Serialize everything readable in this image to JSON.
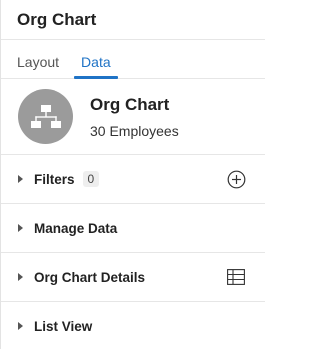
{
  "header": {
    "title": "Org Chart"
  },
  "tabs": [
    {
      "label": "Layout",
      "active": false
    },
    {
      "label": "Data",
      "active": true
    }
  ],
  "summary": {
    "icon": "org-chart-icon",
    "title": "Org Chart",
    "subtitle": "30 Employees"
  },
  "sections": {
    "filters": {
      "label": "Filters",
      "count": "0",
      "action_icon": "plus-circle-icon"
    },
    "manage_data": {
      "label": "Manage Data"
    },
    "details": {
      "label": "Org Chart Details",
      "action_icon": "table-icon"
    },
    "list_view": {
      "label": "List View"
    }
  },
  "colors": {
    "accent": "#1f73c6",
    "avatar_bg": "#9b9b9b",
    "divider": "#e6e6e6"
  }
}
